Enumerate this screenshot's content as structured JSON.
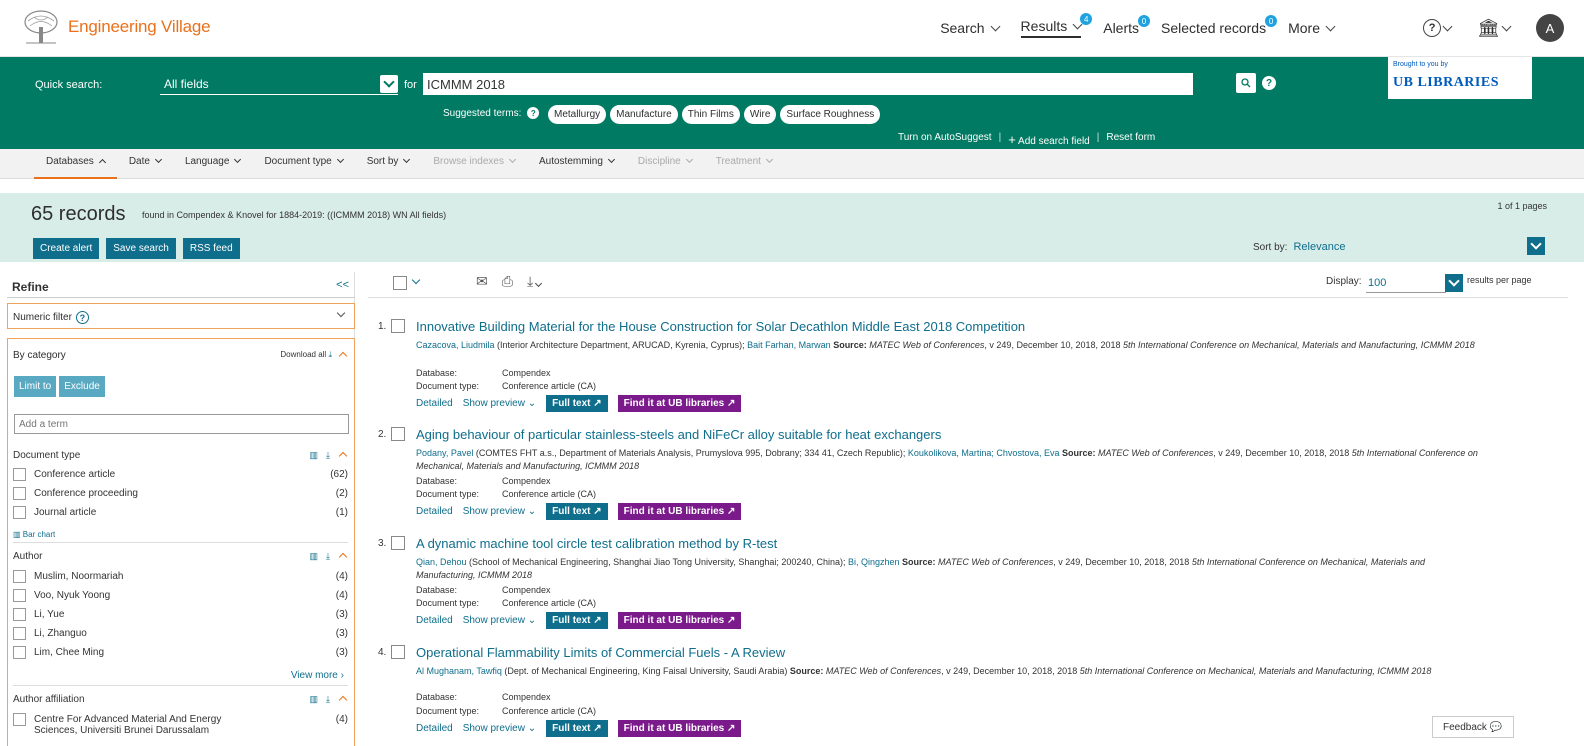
{
  "header": {
    "logo_text": "Engineering Village",
    "nav": [
      {
        "label": "Search",
        "badge": ""
      },
      {
        "label": "Results",
        "badge": "4"
      },
      {
        "label": "Alerts",
        "badge": "0"
      },
      {
        "label": "Selected records",
        "badge": "0"
      },
      {
        "label": "More",
        "badge": ""
      }
    ],
    "avatar_initial": "A"
  },
  "search": {
    "quick_search_label": "Quick search:",
    "field_value": "All fields",
    "for_label": "for",
    "query": "ICMMM 2018",
    "brought_by": "Brought to you by",
    "library_name": "LIBRARIES",
    "library_prefix": "UB",
    "suggested_label": "Suggested terms:",
    "suggested_terms": [
      "Metallurgy",
      "Manufacture",
      "Thin Films",
      "Wire",
      "Surface Roughness"
    ],
    "autosuggest": "Turn on AutoSuggest",
    "add_field": "Add search field",
    "reset": "Reset form"
  },
  "filters": [
    {
      "label": "Databases",
      "state": "active"
    },
    {
      "label": "Date",
      "state": "normal"
    },
    {
      "label": "Language",
      "state": "normal"
    },
    {
      "label": "Document type",
      "state": "normal"
    },
    {
      "label": "Sort by",
      "state": "normal"
    },
    {
      "label": "Browse indexes",
      "state": "disabled"
    },
    {
      "label": "Autostemming",
      "state": "normal"
    },
    {
      "label": "Discipline",
      "state": "disabled"
    },
    {
      "label": "Treatment",
      "state": "disabled"
    }
  ],
  "summary": {
    "count": "65 records",
    "found_text": "found in Compendex & Knovel for 1884-2019: ((ICMMM 2018) WN All fields)",
    "pages": "1 of 1 pages",
    "create_alert": "Create alert",
    "save_search": "Save search",
    "rss_feed": "RSS feed",
    "sort_label": "Sort by:",
    "sort_value": "Relevance"
  },
  "refine": {
    "title": "Refine",
    "collapse": "<<",
    "numeric_filter": "Numeric filter",
    "by_category": "By category",
    "download_all": "Download all",
    "limit_to": "Limit to",
    "exclude": "Exclude",
    "add_term_placeholder": "Add a term",
    "document_type": {
      "title": "Document type",
      "items": [
        {
          "label": "Conference article",
          "count": "(62)"
        },
        {
          "label": "Conference proceeding",
          "count": "(2)"
        },
        {
          "label": "Journal article",
          "count": "(1)"
        }
      ],
      "bar_chart": "Bar chart"
    },
    "author": {
      "title": "Author",
      "items": [
        {
          "label": "Muslim, Noormariah",
          "count": "(4)"
        },
        {
          "label": "Voo, Nyuk Yoong",
          "count": "(4)"
        },
        {
          "label": "Li, Yue",
          "count": "(3)"
        },
        {
          "label": "Li, Zhanguo",
          "count": "(3)"
        },
        {
          "label": "Lim, Chee Ming",
          "count": "(3)"
        }
      ],
      "view_more": "View more"
    },
    "affiliation": {
      "title": "Author affiliation",
      "items": [
        {
          "label": "Centre For Advanced Material And Energy Sciences, Universiti Brunei Darussalam",
          "count": "(4)"
        }
      ]
    }
  },
  "toolbar": {
    "display_label": "Display:",
    "display_value": "100",
    "per_page": "results per page"
  },
  "results": [
    {
      "num": "1.",
      "title": "Innovative Building Material for the House Construction for Solar Decathlon Middle East 2018 Competition",
      "author1": "Cazacova, Liudmila",
      "affil1": " (Interior Architecture Department, ARUCAD, Kyrenia, Cyprus); ",
      "author2": "Bait Farhan, Marwan",
      "source_label": " Source: ",
      "source": "MATEC Web of Conferences",
      "source_details": ", v 249, December 10, 2018, 2018 ",
      "conference": "5th International Conference on Mechanical, Materials and Manufacturing, ICMMM 2018",
      "database_label": "Database:",
      "database": "Compendex",
      "doctype_label": "Document type:",
      "doctype": "Conference article (CA)"
    },
    {
      "num": "2.",
      "title": "Aging behaviour of particular stainless-steels and NiFeCr alloy suitable for heat exchangers",
      "author1": "Podany, Pavel",
      "affil1": " (COMTES FHT a.s., Department of Materials Analysis, Prumyslova 995, Dobrany; 334 41, Czech Republic); ",
      "author2": "Koukolikova, Martina; Chvostova, Eva",
      "source_label": " Source: ",
      "source": "MATEC Web of Conferences",
      "source_details": ", v 249, December 10, 2018, 2018 ",
      "conference": "5th International Conference on Mechanical, Materials and Manufacturing, ICMMM 2018",
      "database_label": "Database:",
      "database": "Compendex",
      "doctype_label": "Document type:",
      "doctype": "Conference article (CA)"
    },
    {
      "num": "3.",
      "title": "A dynamic machine tool circle test calibration method by R-test",
      "author1": "Qian, Dehou",
      "affil1": " (School of Mechanical Engineering, Shanghai Jiao Tong University, Shanghai; 200240, China); ",
      "author2": "Bi, Qingzhen",
      "source_label": " Source: ",
      "source": "MATEC Web of Conferences",
      "source_details": ", v 249, December 10, 2018, 2018 ",
      "conference": "5th International Conference on Mechanical, Materials and Manufacturing, ICMMM 2018",
      "database_label": "Database:",
      "database": "Compendex",
      "doctype_label": "Document type:",
      "doctype": "Conference article (CA)"
    },
    {
      "num": "4.",
      "title": "Operational Flammability Limits of Commercial Fuels - A Review",
      "author1": "Al Mughanam, Tawfiq",
      "affil1": " (Dept. of Mechanical Engineering, King Faisal University, Saudi Arabia)",
      "author2": "",
      "source_label": " Source: ",
      "source": "MATEC Web of Conferences",
      "source_details": ", v 249, December 10, 2018, 2018 ",
      "conference": "5th International Conference on Mechanical, Materials and Manufacturing, ICMMM 2018",
      "database_label": "Database:",
      "database": "Compendex",
      "doctype_label": "Document type:",
      "doctype": "Conference article (CA)"
    }
  ],
  "result_actions": {
    "detailed": "Detailed",
    "show_preview": "Show preview",
    "full_text": "Full text",
    "find_it": "Find it at UB libraries"
  },
  "feedback": "Feedback"
}
